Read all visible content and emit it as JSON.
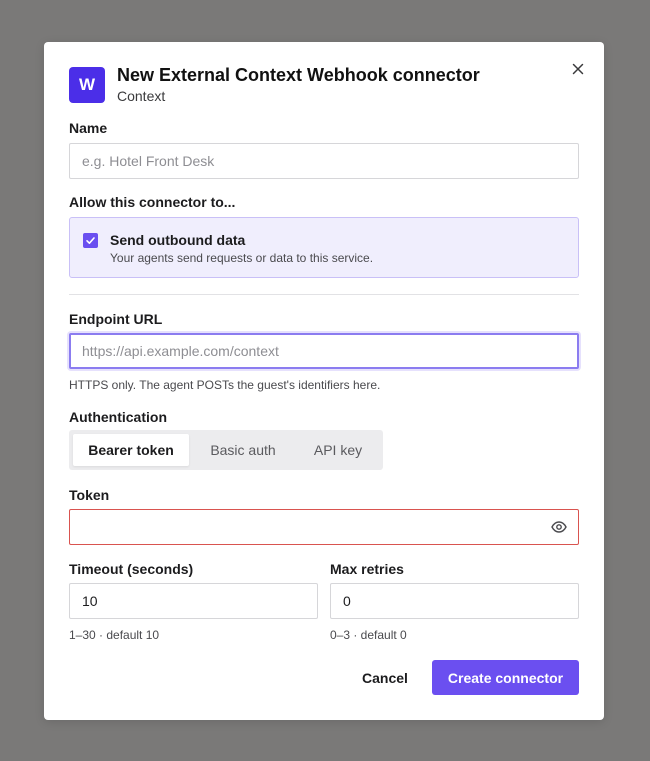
{
  "dialog": {
    "logo_letter": "W",
    "title": "New External Context Webhook connector",
    "subtitle": "Context"
  },
  "name_field": {
    "label": "Name",
    "value": "",
    "placeholder": "e.g. Hotel Front Desk"
  },
  "permissions": {
    "label": "Allow this connector to...",
    "items": [
      {
        "title": "Send outbound data",
        "description": "Your agents send requests or data to this service.",
        "checked": true
      }
    ]
  },
  "endpoint": {
    "label": "Endpoint URL",
    "value": "",
    "placeholder": "https://api.example.com/context",
    "hint": "HTTPS only. The agent POSTs the guest's identifiers here."
  },
  "auth": {
    "label": "Authentication",
    "tabs": [
      "Bearer token",
      "Basic auth",
      "API key"
    ],
    "selected": "Bearer token"
  },
  "token": {
    "label": "Token",
    "value": ""
  },
  "timeout": {
    "label": "Timeout (seconds)",
    "value": "10",
    "hint": "1–30 · default 10"
  },
  "retries": {
    "label": "Max retries",
    "value": "0",
    "hint": "0–3 · default 0"
  },
  "actions": {
    "cancel": "Cancel",
    "create": "Create connector"
  },
  "icons": {
    "close": "close-icon",
    "check": "check-icon",
    "reveal": "eye-icon"
  },
  "colors": {
    "accent": "#6b4ff0",
    "logo": "#4b2ee8",
    "error_border": "#d9534f",
    "permission_bg": "#f0eefd"
  }
}
